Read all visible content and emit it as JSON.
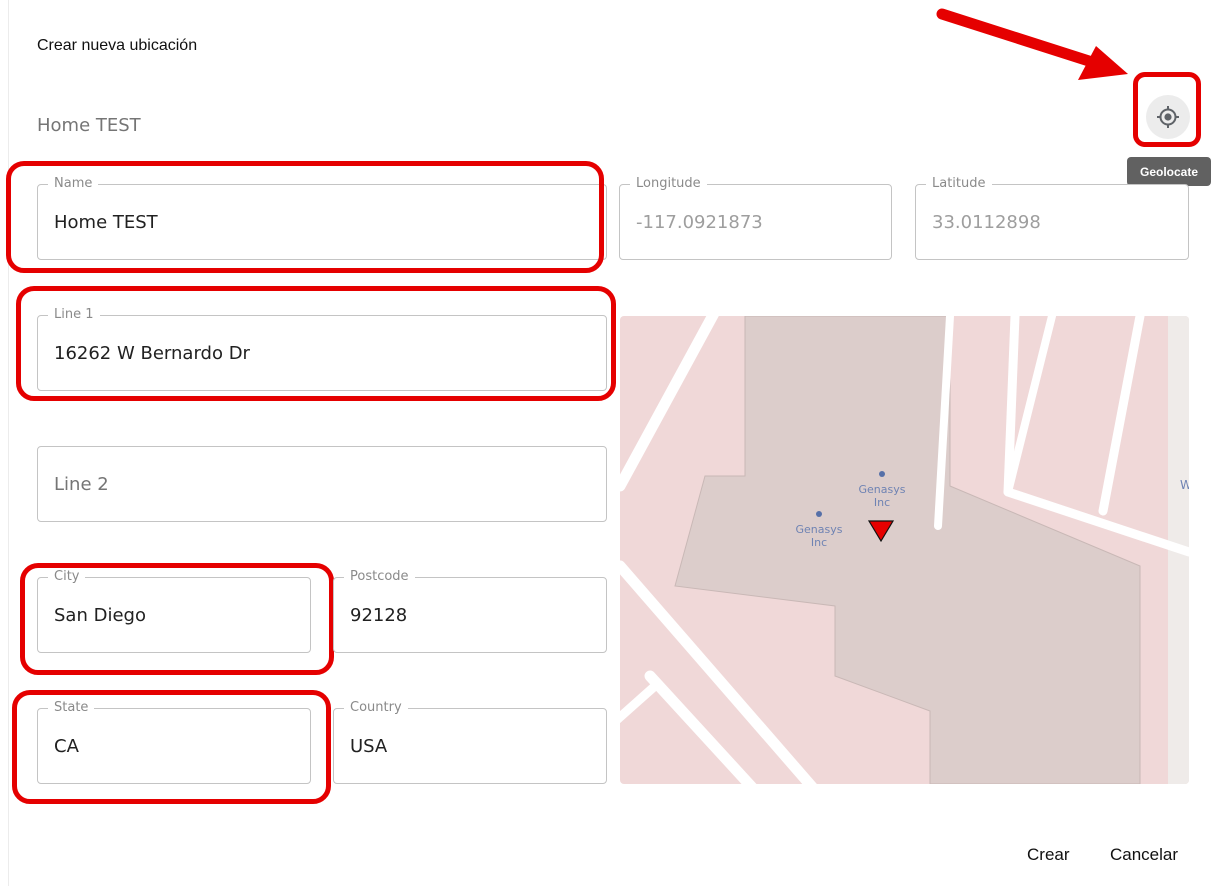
{
  "dialog": {
    "title": "Crear nueva ubicación",
    "subtitle": "Home TEST"
  },
  "geolocate": {
    "icon": "my-location-icon",
    "tooltip": "Geolocate"
  },
  "fields": {
    "name": {
      "label": "Name",
      "value": "Home TEST"
    },
    "longitude": {
      "label": "Longitude",
      "value": "-117.0921873"
    },
    "latitude": {
      "label": "Latitude",
      "value": "33.0112898"
    },
    "line1": {
      "label": "Line 1",
      "value": "16262 W Bernardo Dr"
    },
    "line2": {
      "placeholder": "Line 2"
    },
    "city": {
      "label": "City",
      "value": "San Diego"
    },
    "postcode": {
      "label": "Postcode",
      "value": "92128"
    },
    "state": {
      "label": "State",
      "value": "CA"
    },
    "country": {
      "label": "Country",
      "value": "USA"
    }
  },
  "map": {
    "pois": [
      {
        "label_line1": "Genasys",
        "label_line2": "Inc"
      },
      {
        "label_line1": "Genasys",
        "label_line2": "Inc"
      }
    ],
    "edge_label": "W",
    "marker_color": "#e60000"
  },
  "actions": {
    "create": "Crear",
    "cancel": "Cancelar"
  },
  "colors": {
    "highlight": "#e50000",
    "tooltip_bg": "#616161"
  }
}
